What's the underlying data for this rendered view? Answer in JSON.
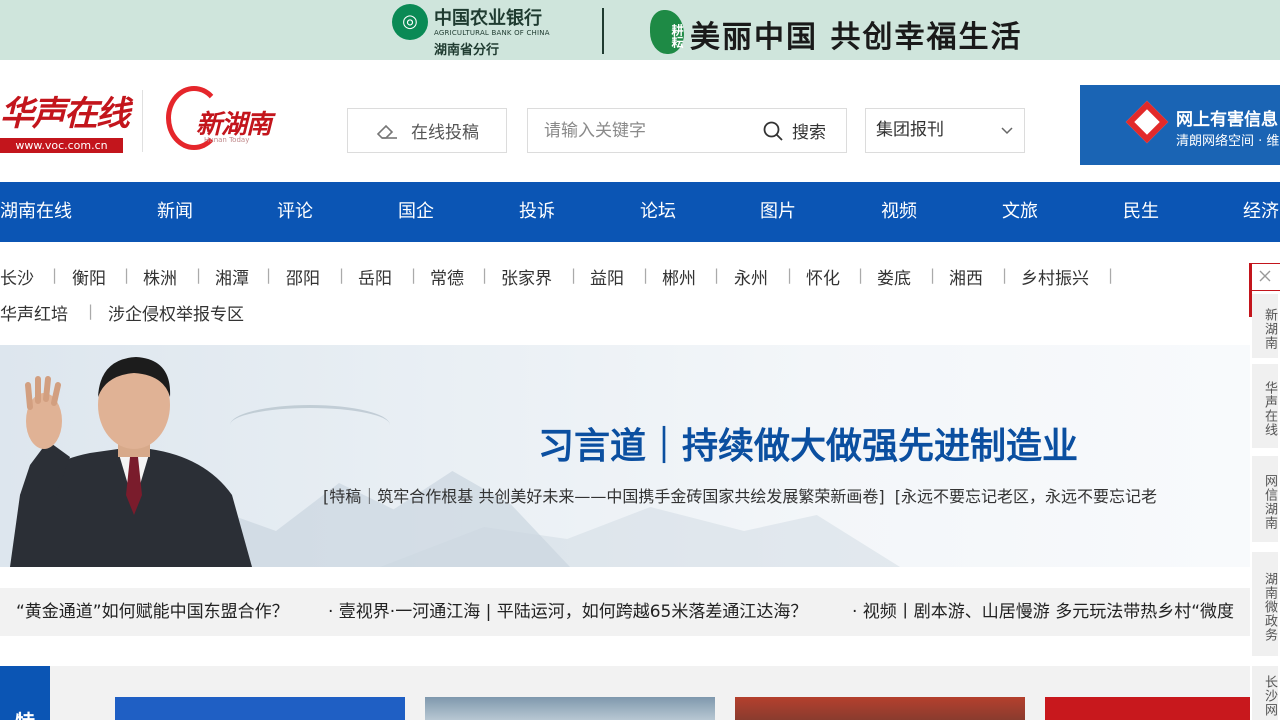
{
  "top_banner": {
    "bank_name": "中国农业银行",
    "bank_en": "AGRICULTURAL BANK OF CHINA",
    "bank_branch": "湖南省分行",
    "seal": "耕耘",
    "slogan": "美丽中国  共创幸福生活"
  },
  "header": {
    "voc_logo_text": "华声在线",
    "voc_url": "www.voc.com.cn",
    "hunan_logo_text": "新湖南",
    "hunan_logo_en": "Hunan Today",
    "submit_label": "在线投稿",
    "search_placeholder": "请输入关键字",
    "search_label": "搜索",
    "select_value": "集团报刊",
    "ad_title": "网上有害信息",
    "ad_sub": "清朗网络空间 · 维"
  },
  "nav": {
    "items": [
      "湖南在线",
      "新闻",
      "评论",
      "国企",
      "投诉",
      "论坛",
      "图片",
      "视频",
      "文旅",
      "民生",
      "经济"
    ]
  },
  "subnav": {
    "row1": [
      "长沙",
      "衡阳",
      "株洲",
      "湘潭",
      "邵阳",
      "岳阳",
      "常德",
      "张家界",
      "益阳",
      "郴州",
      "永州",
      "怀化",
      "娄底",
      "湘西",
      "乡村振兴"
    ],
    "row2": [
      "华声红培",
      "涉企侵权举报专区"
    ]
  },
  "hero": {
    "headline": "习言道｜持续做大做强先进制造业",
    "link1": "[特稿｜筑牢合作根基 共创美好未来——中国携手金砖国家共绘发展繁荣新画卷]",
    "link2": "[永远不要忘记老区，永远不要忘记老"
  },
  "ticker": {
    "items": [
      "“黄金通道”如何赋能中国东盟合作？",
      "· 壹视界·一河通江海 | 平陆运河，如何跨越65米落差通江达海？",
      "· 视频丨剧本游、山居慢游 多元玩法带热乡村“微度"
    ]
  },
  "bottom": {
    "special_label": "特"
  },
  "sidebar": {
    "items": [
      "新湖南",
      "华声在线",
      "网信湖南",
      "湖南微政务",
      "长沙网"
    ]
  },
  "colors": {
    "nav_blue": "#0b55b4",
    "brand_red": "#c3151c",
    "headline_blue": "#0b4fa0",
    "banner_green": "#cfe5dc"
  }
}
